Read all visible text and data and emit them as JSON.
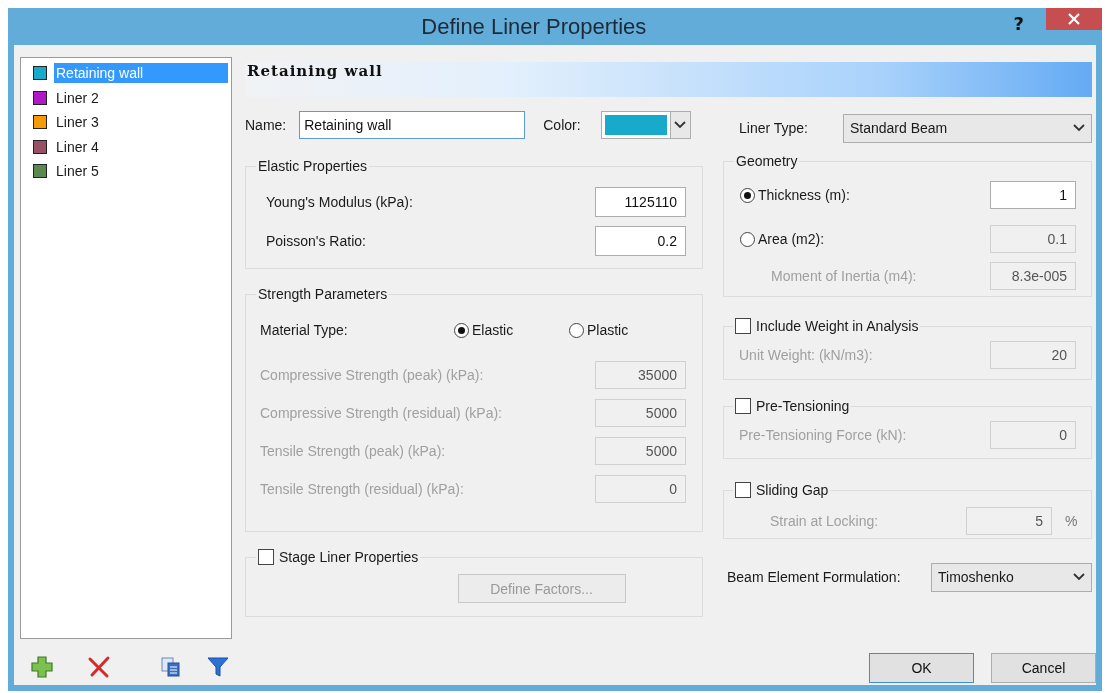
{
  "window": {
    "title": "Define Liner Properties",
    "help": "?"
  },
  "liners": [
    {
      "name": "Retaining wall",
      "color": "#17aacb",
      "selected": true
    },
    {
      "name": "Liner 2",
      "color": "#b018c8",
      "selected": false
    },
    {
      "name": "Liner 3",
      "color": "#f79a0a",
      "selected": false
    },
    {
      "name": "Liner 4",
      "color": "#985064",
      "selected": false
    },
    {
      "name": "Liner 5",
      "color": "#5a8a50",
      "selected": false
    }
  ],
  "header": "Retaining wall",
  "name": {
    "label": "Name:",
    "value": "Retaining wall"
  },
  "color": {
    "label": "Color:",
    "color": "#17aacb"
  },
  "liner_type": {
    "label": "Liner Type:",
    "value": "Standard Beam"
  },
  "elastic": {
    "title": "Elastic Properties",
    "fields": [
      {
        "label": "Young's Modulus (kPa):",
        "value": "1125110",
        "disabled": false
      },
      {
        "label": "Poisson's Ratio:",
        "value": "0.2",
        "disabled": false
      }
    ]
  },
  "strength": {
    "title": "Strength Parameters",
    "material_label": "Material Type:",
    "options": [
      {
        "label": "Elastic",
        "selected": true
      },
      {
        "label": "Plastic",
        "selected": false
      }
    ],
    "fields": [
      {
        "label": "Compressive Strength (peak) (kPa):",
        "value": "35000",
        "disabled": true
      },
      {
        "label": "Compressive Strength (residual) (kPa):",
        "value": "5000",
        "disabled": true
      },
      {
        "label": "Tensile Strength (peak) (kPa):",
        "value": "5000",
        "disabled": true
      },
      {
        "label": "Tensile Strength (residual) (kPa):",
        "value": "0",
        "disabled": true
      }
    ]
  },
  "stage": {
    "label": "Stage Liner Properties",
    "checked": false,
    "button": "Define Factors...",
    "button_disabled": true
  },
  "geometry": {
    "title": "Geometry",
    "rows": [
      {
        "kind": "radio",
        "label": "Thickness (m):",
        "selected": true,
        "value": "1",
        "disabled": false
      },
      {
        "kind": "radio",
        "label": "Area (m2):",
        "selected": false,
        "value": "0.1",
        "disabled": true
      },
      {
        "kind": "field",
        "label": "Moment of Inertia (m4):",
        "value": "8.3e-005",
        "disabled": true
      }
    ]
  },
  "options": [
    {
      "label": "Include Weight in Analysis",
      "checked": false,
      "field_label": "Unit Weight: (kN/m3):",
      "value": "20",
      "disabled": true
    },
    {
      "label": "Pre-Tensioning",
      "checked": false,
      "field_label": "Pre-Tensioning Force (kN):",
      "value": "0",
      "disabled": true
    },
    {
      "label": "Sliding Gap",
      "checked": false,
      "field_label": "Strain at Locking:",
      "value": "5",
      "unit": "%",
      "disabled": true
    }
  ],
  "beam": {
    "label": "Beam Element Formulation:",
    "value": "Timoshenko"
  },
  "buttons": [
    {
      "label": "OK",
      "default": true
    },
    {
      "label": "Cancel",
      "default": false
    }
  ]
}
